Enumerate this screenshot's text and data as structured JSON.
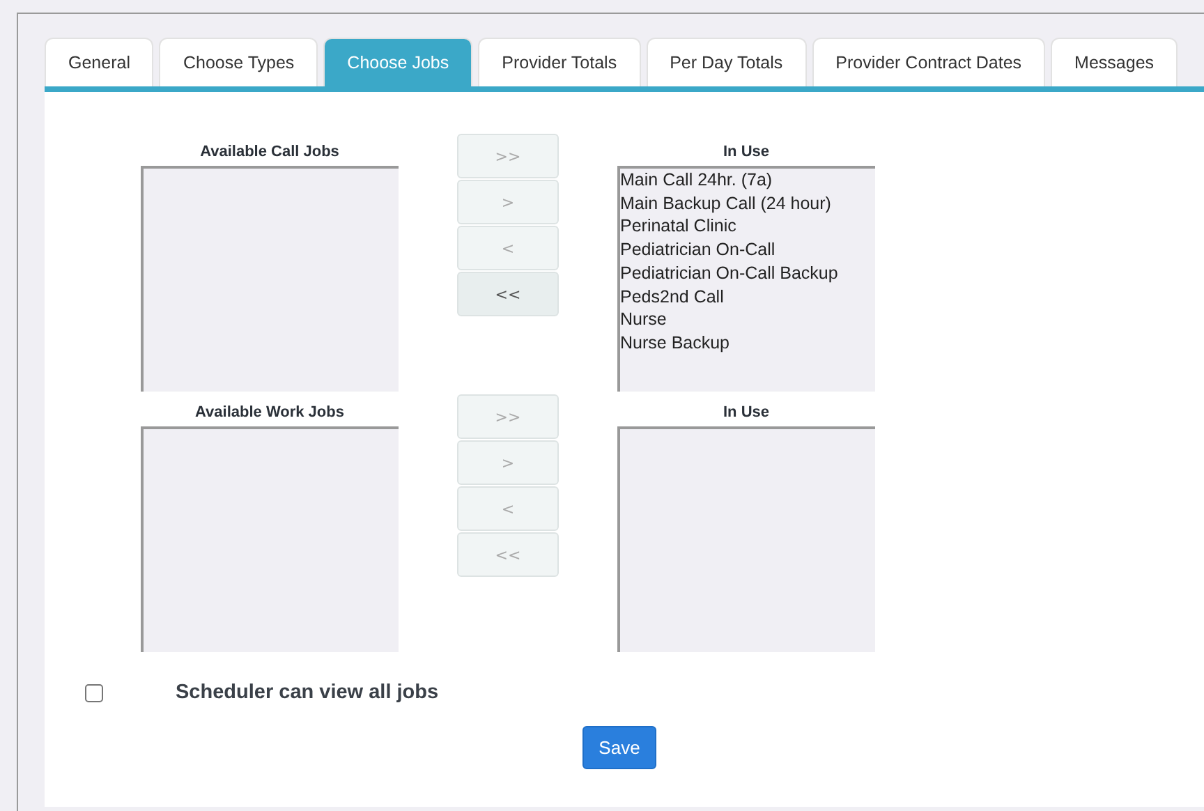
{
  "tabs": [
    {
      "label": "General",
      "selected": false
    },
    {
      "label": "Choose Types",
      "selected": false
    },
    {
      "label": "Choose Jobs",
      "selected": true
    },
    {
      "label": "Provider Totals",
      "selected": false
    },
    {
      "label": "Per Day Totals",
      "selected": false
    },
    {
      "label": "Provider Contract Dates",
      "selected": false
    },
    {
      "label": "Messages",
      "selected": false
    }
  ],
  "sections": [
    {
      "available_title": "Available Call Jobs",
      "in_use_title": "In Use",
      "in_use_items": [
        "Main Call 24hr. (7a)",
        "Main Backup Call (24 hour)",
        "Perinatal Clinic",
        "Pediatrician On-Call",
        "Pediatrician On-Call Backup",
        "Peds2nd Call",
        "Nurse",
        "Nurse Backup"
      ],
      "buttons": [
        {
          "label": ">>",
          "disabled": true
        },
        {
          "label": ">",
          "disabled": true
        },
        {
          "label": "<",
          "disabled": true
        },
        {
          "label": "<<",
          "disabled": false
        }
      ]
    },
    {
      "available_title": "Available Work Jobs",
      "in_use_title": "In Use",
      "buttons": [
        {
          "label": ">>",
          "disabled": true
        },
        {
          "label": ">",
          "disabled": true
        },
        {
          "label": "<",
          "disabled": true
        },
        {
          "label": "<<",
          "disabled": true
        }
      ]
    }
  ],
  "scheduler_option": {
    "label": "Scheduler can view all jobs",
    "checked": false
  },
  "save_button": "Save"
}
